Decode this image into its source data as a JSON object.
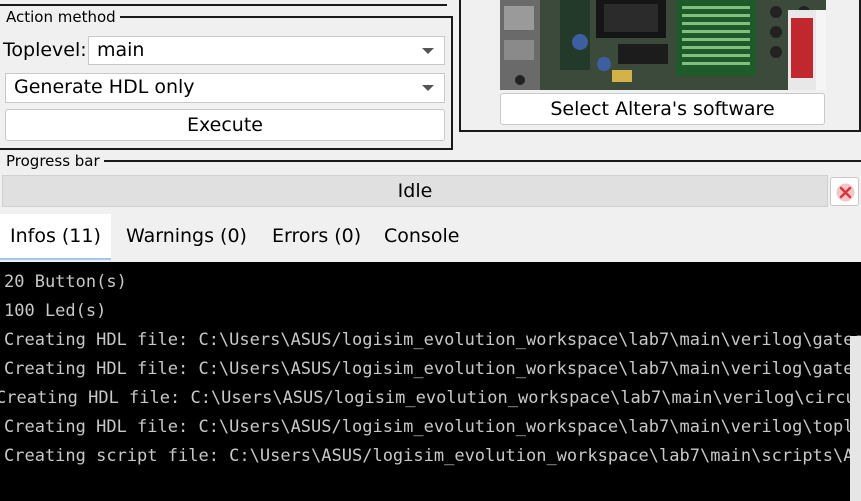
{
  "action_method": {
    "legend": "Action method",
    "toplevel_label": "Toplevel:",
    "toplevel_value": "main",
    "action_value": "Generate HDL only",
    "execute_label": "Execute"
  },
  "board": {
    "select_software_label": "Select Altera's software"
  },
  "progress": {
    "legend": "Progress bar",
    "status": "Idle",
    "fraction": 0
  },
  "tabs": [
    {
      "label": "Infos (11)",
      "active": true
    },
    {
      "label": "Warnings (0)",
      "active": false
    },
    {
      "label": "Errors (0)",
      "active": false
    },
    {
      "label": "Console",
      "active": false
    }
  ],
  "console": {
    "lines": [
      "20 Button(s)",
      "100 Led(s)",
      "Creating HDL file: C:\\Users\\ASUS/logisim_evolution_workspace\\lab7\\main\\verilog\\gates\\",
      "Creating HDL file: C:\\Users\\ASUS/logisim_evolution_workspace\\lab7\\main\\verilog\\gates\\",
      "Creating HDL file: C:\\Users\\ASUS/logisim_evolution_workspace\\lab7\\main\\verilog\\circuit",
      "Creating HDL file: C:\\Users\\ASUS/logisim_evolution_workspace\\lab7\\main\\verilog\\toplev",
      "Creating script file: C:\\Users\\ASUS/logisim_evolution_workspace\\lab7\\main\\scripts\\Alt"
    ]
  },
  "colors": {
    "console_bg": "#000000",
    "console_text": "#c8c8c8",
    "tab_active": "#ffffff",
    "tab_accent": "#cfe5f7",
    "clear_icon": "#d9363e"
  }
}
